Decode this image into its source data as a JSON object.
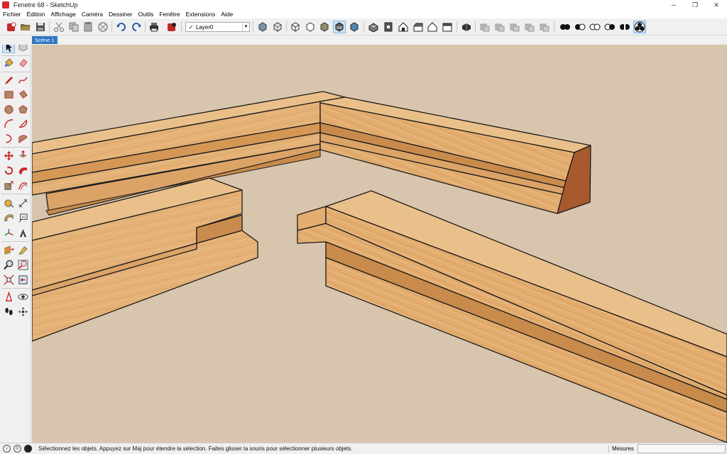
{
  "window": {
    "title": "Fenetre 68 - SketchUp",
    "minimize": "─",
    "maximize": "❐",
    "close": "✕"
  },
  "menu": [
    "Fichier",
    "Édition",
    "Affichage",
    "Caméra",
    "Dessiner",
    "Outils",
    "Fenêtre",
    "Extensions",
    "Aide"
  ],
  "toolbar": {
    "layer_current": "Layer0",
    "layer_check": "✓",
    "layer_dropdown_arrow": "▼"
  },
  "scenes": [
    {
      "label": "Scène 1",
      "active": true
    }
  ],
  "status": {
    "message": "Sélectionnez les objets. Appuyez sur Maj pour étendre la sélection. Faites glisser la souris pour sélectionner plusieurs objets.",
    "measures_label": "Mesures",
    "measures_value": "",
    "icon_info": "i",
    "icon_credit": "©"
  },
  "colors": {
    "viewport_bg": "#d8c5ad",
    "wood_top": "#e6b67a",
    "wood_front": "#d99e5f",
    "wood_side": "#a05a2e",
    "accent": "#2e76c0"
  },
  "toolbar_icons": [
    "get-started-icon",
    "open-icon",
    "save-icon",
    "cut-icon",
    "copy-icon",
    "paste-icon",
    "erase-icon",
    "undo-icon",
    "redo-icon",
    "print-icon",
    "model-info-icon",
    "xray-icon",
    "back-edges-icon",
    "wireframe-icon",
    "hidden-line-icon",
    "shaded-icon",
    "shaded-textures-icon",
    "monochrome-icon",
    "iso-view-icon",
    "top-view-icon",
    "front-view-icon",
    "right-view-icon",
    "back-view-icon",
    "left-view-icon",
    "components-icon",
    "solid-outer-shell-icon",
    "solid-intersect-icon",
    "solid-union-icon",
    "solid-subtract-icon",
    "solid-trim-icon",
    "solid-split-icon",
    "shadow-toggle-1-icon",
    "shadow-toggle-2-icon",
    "shadow-toggle-3-icon",
    "shadow-toggle-4-icon",
    "shadow-toggle-5-icon",
    "style-toggle-icon"
  ],
  "left_tools": [
    "select-icon",
    "make-component-icon",
    "paint-bucket-icon",
    "eraser-icon",
    "pencil-line-icon",
    "freehand-icon",
    "rectangle-icon",
    "rotated-rectangle-icon",
    "circle-icon",
    "polygon-icon",
    "arc-icon",
    "pie-icon",
    "two-point-arc-icon",
    "three-point-arc-icon",
    "move-icon",
    "push-pull-icon",
    "rotate-icon",
    "follow-me-icon",
    "scale-icon",
    "offset-icon",
    "tape-measure-icon",
    "dimension-icon",
    "protractor-icon",
    "text-icon",
    "axes-icon",
    "3d-text-icon",
    "section-plane-icon",
    "paint-icon",
    "zoom-icon",
    "zoom-window-icon",
    "zoom-extents-icon",
    "previous-view-icon",
    "position-camera-icon",
    "look-around-icon",
    "walk-icon",
    "orbit-icon"
  ]
}
